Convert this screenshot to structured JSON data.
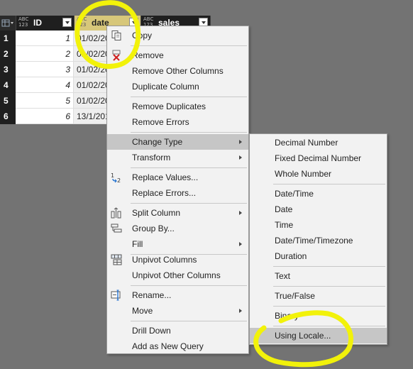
{
  "grid": {
    "columns": [
      {
        "type_tag": "ABC\n123",
        "name": "ID"
      },
      {
        "type_tag": "ABC\n123",
        "name": "date"
      },
      {
        "type_tag": "ABC\n123",
        "name": "sales"
      }
    ],
    "rows": [
      {
        "n": "1",
        "id": "1",
        "date": "01/02/20"
      },
      {
        "n": "2",
        "id": "2",
        "date": "01/02/20"
      },
      {
        "n": "3",
        "id": "3",
        "date": "01/02/20"
      },
      {
        "n": "4",
        "id": "4",
        "date": "01/02/20"
      },
      {
        "n": "5",
        "id": "5",
        "date": "01/02/20"
      },
      {
        "n": "6",
        "id": "6",
        "date": "13/1/201"
      }
    ]
  },
  "context_menu": {
    "copy": "Copy",
    "remove": "Remove",
    "remove_other_columns": "Remove Other Columns",
    "duplicate_column": "Duplicate Column",
    "remove_duplicates": "Remove Duplicates",
    "remove_errors": "Remove Errors",
    "change_type": "Change Type",
    "transform": "Transform",
    "replace_values": "Replace Values...",
    "replace_errors": "Replace Errors...",
    "split_column": "Split Column",
    "group_by": "Group By...",
    "fill": "Fill",
    "unpivot_columns": "Unpivot Columns",
    "unpivot_other_columns": "Unpivot Other Columns",
    "rename": "Rename...",
    "move": "Move",
    "drill_down": "Drill Down",
    "add_as_new_query": "Add as New Query"
  },
  "type_submenu": {
    "decimal_number": "Decimal Number",
    "fixed_decimal_number": "Fixed Decimal Number",
    "whole_number": "Whole Number",
    "date_time": "Date/Time",
    "date": "Date",
    "time": "Time",
    "date_time_timezone": "Date/Time/Timezone",
    "duration": "Duration",
    "text": "Text",
    "true_false": "True/False",
    "binary": "Binary",
    "using_locale": "Using Locale..."
  },
  "icons": {
    "copy": "copy-icon",
    "remove": "remove-column-icon",
    "replace_values": "replace-values-icon",
    "split_column": "split-column-icon",
    "group_by": "group-by-icon",
    "unpivot_columns": "unpivot-icon",
    "rename": "rename-icon"
  },
  "colors": {
    "highlight_annotation": "#f2f20a",
    "selected_column_header": "#d7c77a",
    "menu_highlight": "#c6c6c6"
  }
}
